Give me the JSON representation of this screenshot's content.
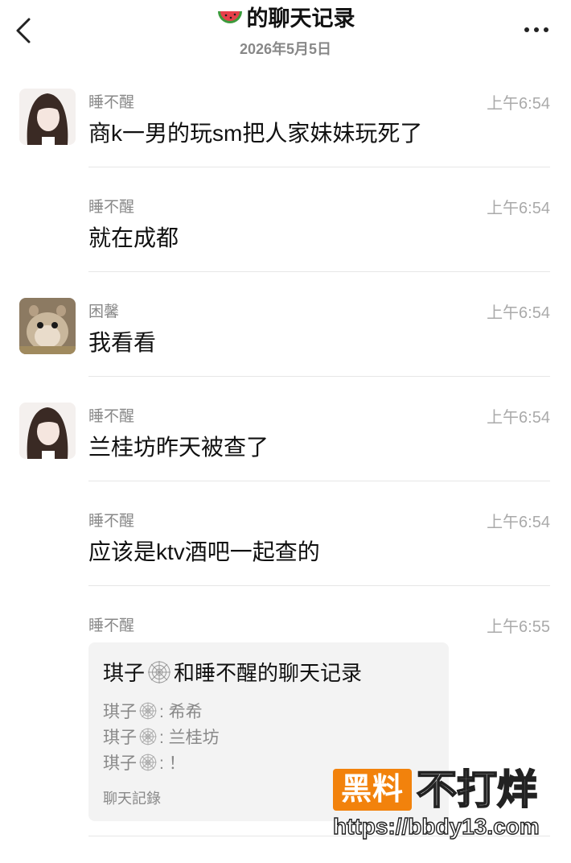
{
  "header": {
    "title": "的聊天记录",
    "title_icon": "watermelon-icon",
    "date": "2026年5月5日"
  },
  "messages": [
    {
      "sender": "睡不醒",
      "time": "上午6:54",
      "text": "商k一男的玩sm把人家妹妹玩死了",
      "avatar": "anime-girl-avatar"
    },
    {
      "sender": "睡不醒",
      "time": "上午6:54",
      "text": "就在成都"
    },
    {
      "sender": "困馨",
      "time": "上午6:54",
      "text": "我看看",
      "avatar": "hamster-avatar"
    },
    {
      "sender": "睡不醒",
      "time": "上午6:54",
      "text": "兰桂坊昨天被查了",
      "avatar": "anime-girl-avatar"
    },
    {
      "sender": "睡不醒",
      "time": "上午6:54",
      "text": "应该是ktv酒吧一起查的"
    },
    {
      "sender": "睡不醒",
      "time": "上午6:55"
    }
  ],
  "forward_card": {
    "title_prefix": "琪子",
    "title_suffix": "和睡不醒的聊天记录",
    "lines": [
      {
        "name": "琪子",
        "text": ": 希希"
      },
      {
        "name": "琪子",
        "text": ": 兰桂坊"
      },
      {
        "name": "琪子",
        "text": ": ！"
      }
    ],
    "footer": "聊天記錄"
  },
  "watermark": {
    "box_text": "黑料",
    "big_text": "不打烊",
    "url": "https://bbdy13.com"
  },
  "colors": {
    "watermark_orange": "#f2820c",
    "card_bg": "#f3f3f3",
    "meta_gray": "#888888"
  }
}
